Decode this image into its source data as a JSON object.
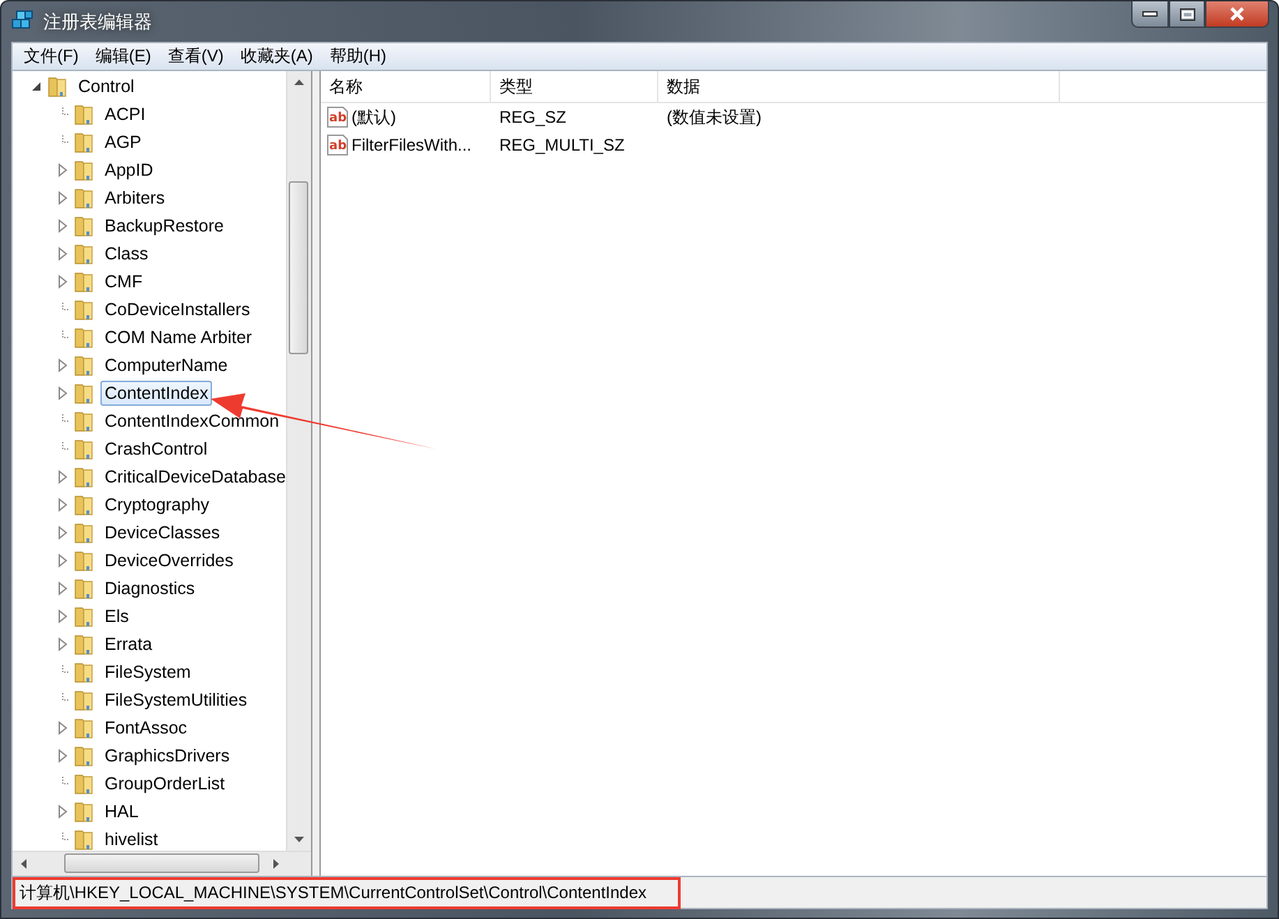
{
  "window": {
    "title": "注册表编辑器"
  },
  "menu": [
    "文件(F)",
    "编辑(E)",
    "查看(V)",
    "收藏夹(A)",
    "帮助(H)"
  ],
  "tree": [
    {
      "label": "Control",
      "expandable": true,
      "expanded": true,
      "selected": false,
      "children": [
        {
          "label": "ACPI",
          "expandable": false,
          "selected": false
        },
        {
          "label": "AGP",
          "expandable": false,
          "selected": false
        },
        {
          "label": "AppID",
          "expandable": true,
          "selected": false
        },
        {
          "label": "Arbiters",
          "expandable": true,
          "selected": false
        },
        {
          "label": "BackupRestore",
          "expandable": true,
          "selected": false
        },
        {
          "label": "Class",
          "expandable": true,
          "selected": false
        },
        {
          "label": "CMF",
          "expandable": true,
          "selected": false
        },
        {
          "label": "CoDeviceInstallers",
          "expandable": false,
          "selected": false
        },
        {
          "label": "COM Name Arbiter",
          "expandable": false,
          "selected": false
        },
        {
          "label": "ComputerName",
          "expandable": true,
          "selected": false
        },
        {
          "label": "ContentIndex",
          "expandable": true,
          "selected": true
        },
        {
          "label": "ContentIndexCommon",
          "expandable": false,
          "selected": false
        },
        {
          "label": "CrashControl",
          "expandable": false,
          "selected": false
        },
        {
          "label": "CriticalDeviceDatabase",
          "expandable": true,
          "selected": false
        },
        {
          "label": "Cryptography",
          "expandable": true,
          "selected": false
        },
        {
          "label": "DeviceClasses",
          "expandable": true,
          "selected": false
        },
        {
          "label": "DeviceOverrides",
          "expandable": true,
          "selected": false
        },
        {
          "label": "Diagnostics",
          "expandable": true,
          "selected": false
        },
        {
          "label": "Els",
          "expandable": true,
          "selected": false
        },
        {
          "label": "Errata",
          "expandable": true,
          "selected": false
        },
        {
          "label": "FileSystem",
          "expandable": false,
          "selected": false
        },
        {
          "label": "FileSystemUtilities",
          "expandable": false,
          "selected": false
        },
        {
          "label": "FontAssoc",
          "expandable": true,
          "selected": false
        },
        {
          "label": "GraphicsDrivers",
          "expandable": true,
          "selected": false
        },
        {
          "label": "GroupOrderList",
          "expandable": false,
          "selected": false
        },
        {
          "label": "HAL",
          "expandable": true,
          "selected": false
        },
        {
          "label": "hivelist",
          "expandable": false,
          "selected": false
        }
      ]
    }
  ],
  "table": {
    "columns": [
      "名称",
      "类型",
      "数据"
    ],
    "rows": [
      {
        "icon_text": "ab",
        "name": "(默认)",
        "type": "REG_SZ",
        "data": "(数值未设置)"
      },
      {
        "icon_text": "ab",
        "name": "FilterFilesWith...",
        "type": "REG_MULTI_SZ"
      }
    ]
  },
  "status_bar": "计算机\\HKEY_LOCAL_MACHINE\\SYSTEM\\CurrentControlSet\\Control\\ContentIndex"
}
